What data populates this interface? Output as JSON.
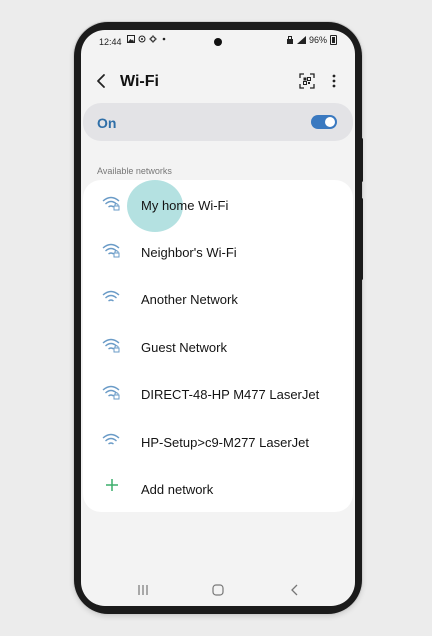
{
  "status_bar": {
    "time": "12:44",
    "battery": "96%",
    "icons": [
      "image-icon",
      "sync-icon",
      "settings-icon",
      "dot-icon"
    ]
  },
  "header": {
    "title": "Wi-Fi",
    "icons": [
      "back-icon",
      "qr-scan-icon",
      "more-options-icon"
    ]
  },
  "wifi_toggle": {
    "label": "On",
    "state": "on",
    "accent": "#3a79c0"
  },
  "available_networks": {
    "title": "Available networks",
    "items": [
      {
        "label": "My home Wi-Fi",
        "secured": true
      },
      {
        "label": "Neighbor's Wi-Fi",
        "secured": true
      },
      {
        "label": "Another Network",
        "secured": false
      },
      {
        "label": "Guest Network",
        "secured": true
      },
      {
        "label": "DIRECT-48-HP M477 LaserJet",
        "secured": true
      },
      {
        "label": "HP-Setup>c9-M277 LaserJet",
        "secured": false
      }
    ],
    "add_label": "Add network"
  },
  "colors": {
    "wifi_icon": "#6a9bc7",
    "add_icon": "#3cae6b",
    "label_accent": "#2f6fa8"
  }
}
